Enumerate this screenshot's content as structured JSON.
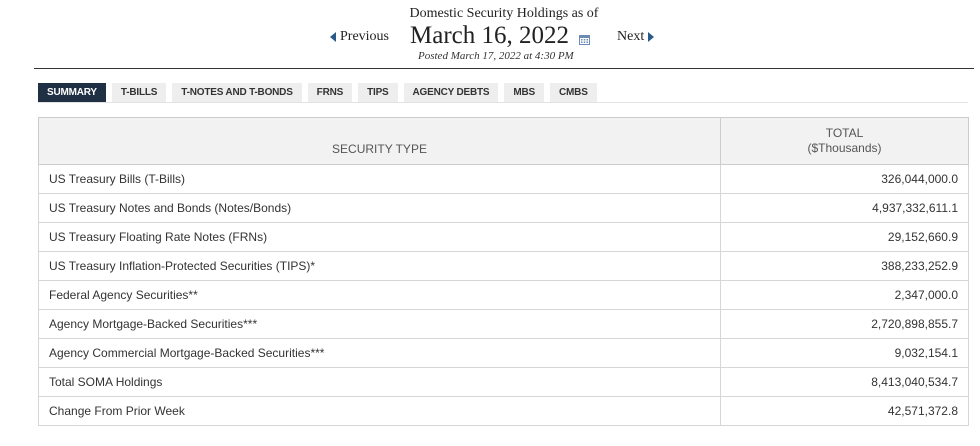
{
  "header": {
    "title": "Domestic Security Holdings as of",
    "prev_label": "Previous",
    "next_label": "Next",
    "date": "March 16, 2022",
    "posted": "Posted March 17, 2022 at 4:30 PM"
  },
  "tabs": [
    {
      "label": "SUMMARY",
      "active": true
    },
    {
      "label": "T-BILLS"
    },
    {
      "label": "T-NOTES AND T-BONDS"
    },
    {
      "label": "FRNS"
    },
    {
      "label": "TIPS"
    },
    {
      "label": "AGENCY DEBTS"
    },
    {
      "label": "MBS"
    },
    {
      "label": "CMBS"
    }
  ],
  "table": {
    "col_type": "SECURITY TYPE",
    "col_total_line1": "TOTAL",
    "col_total_line2": "($Thousands)",
    "rows": [
      {
        "type": "US Treasury Bills (T-Bills)",
        "total": "326,044,000.0"
      },
      {
        "type": "US Treasury Notes and Bonds (Notes/Bonds)",
        "total": "4,937,332,611.1"
      },
      {
        "type": "US Treasury Floating Rate Notes (FRNs)",
        "total": "29,152,660.9"
      },
      {
        "type": "US Treasury Inflation-Protected Securities (TIPS)*",
        "total": "388,233,252.9"
      },
      {
        "type": "Federal Agency Securities**",
        "total": "2,347,000.0"
      },
      {
        "type": "Agency Mortgage-Backed Securities***",
        "total": "2,720,898,855.7"
      },
      {
        "type": "Agency Commercial Mortgage-Backed Securities***",
        "total": "9,032,154.1"
      },
      {
        "type": "Total SOMA Holdings",
        "total": "8,413,040,534.7"
      },
      {
        "type": "Change From Prior Week",
        "total": "42,571,372.8"
      }
    ]
  },
  "colors": {
    "active_tab": "#1f3044",
    "tab_bg": "#eeeeee",
    "arrow": "#2a5a8a"
  },
  "icons": {
    "calendar": "calendar-icon",
    "prev_arrow": "triangle-left-icon",
    "next_arrow": "triangle-right-icon"
  }
}
